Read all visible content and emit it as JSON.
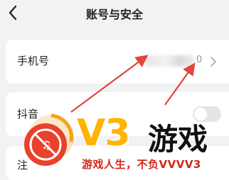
{
  "header": {
    "title": "账号与安全",
    "back_icon": "chevron-left-icon"
  },
  "rows": {
    "phone": {
      "label": "手机号",
      "value_suffix": "0",
      "chevron_icon": "chevron-right-icon"
    },
    "douyin": {
      "label": "抖音"
    },
    "third": {
      "label": "注"
    }
  },
  "watermark": {
    "brand": "V3",
    "brand_suffix": "游戏",
    "slogan": "游戏人生，不负VVVV3",
    "colors": {
      "brand": "#ffb400",
      "slogan": "#d2261b",
      "logo_red": "#e8412c",
      "logo_orange": "#f7a21b"
    }
  },
  "annotation": {
    "arrow_color": "#e2453c"
  }
}
